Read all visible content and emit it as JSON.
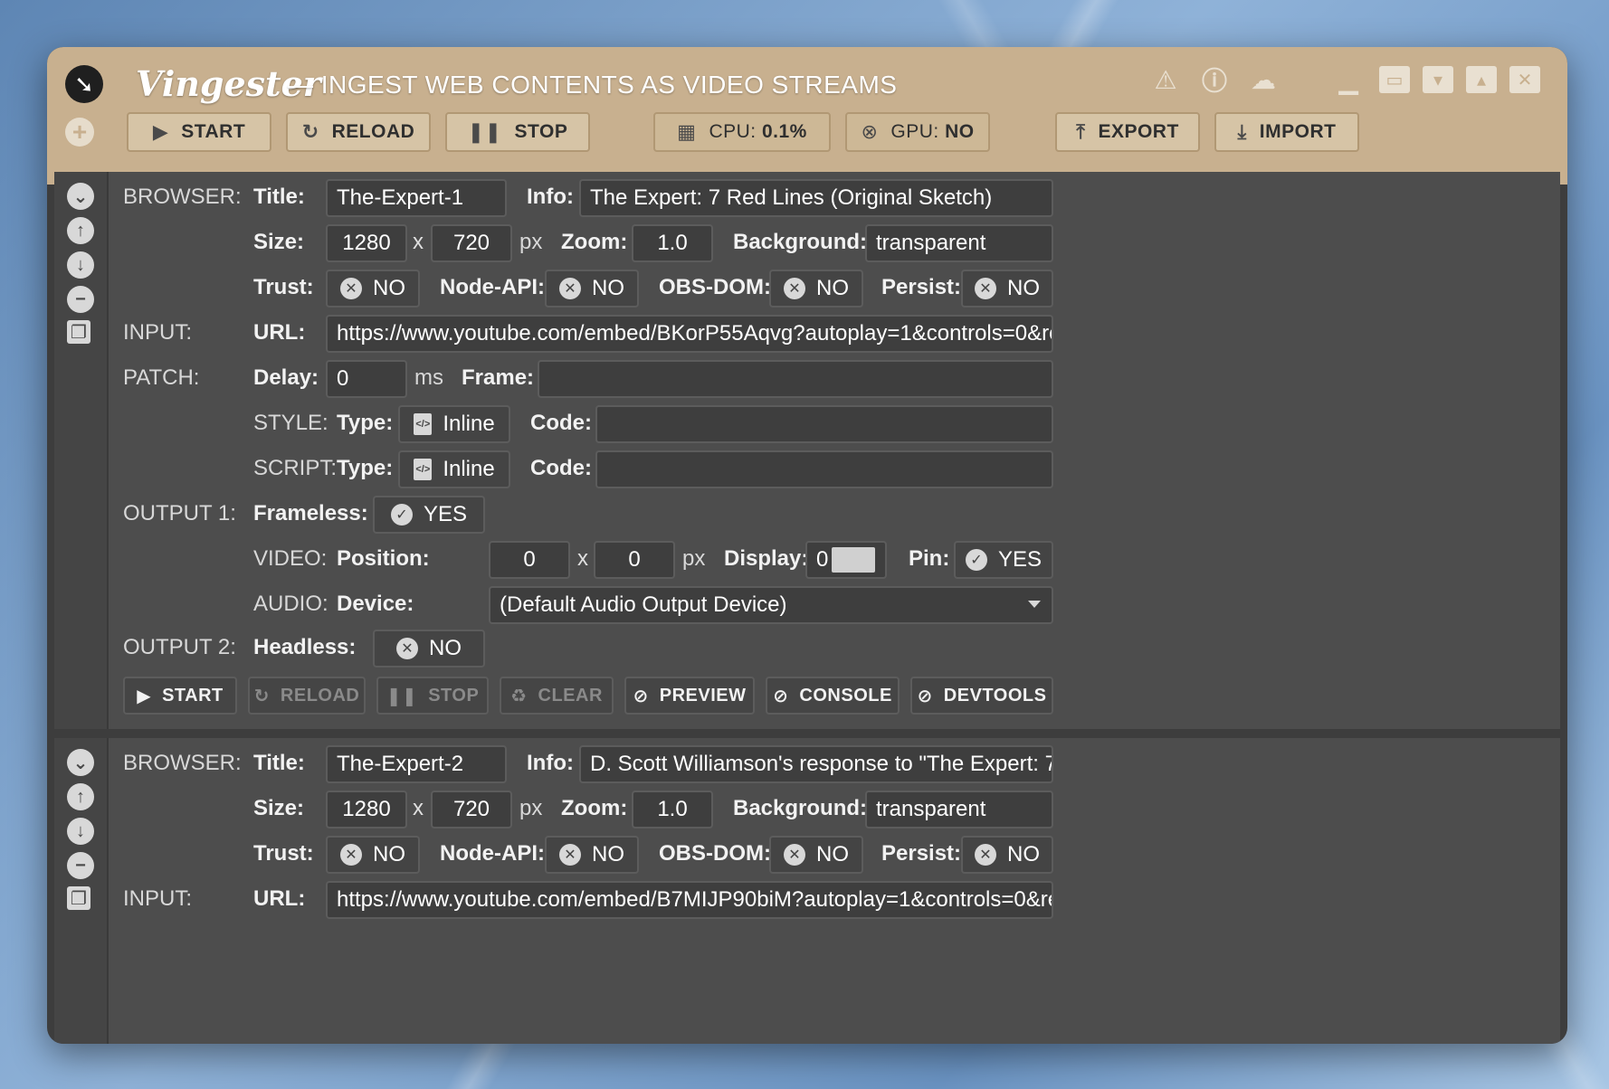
{
  "window": {
    "title": "Vingester",
    "subtitle": "— INGEST WEB CONTENTS AS VIDEO STREAMS"
  },
  "toolbar": {
    "start_label": "START",
    "reload_label": "RELOAD",
    "stop_label": "STOP",
    "cpu_label": "CPU:",
    "cpu_value": "0.1%",
    "gpu_label": "GPU:",
    "gpu_value": "NO",
    "export_label": "EXPORT",
    "import_label": "IMPORT"
  },
  "labels": {
    "browser": "BROWSER:",
    "title": "Title:",
    "info": "Info:",
    "size": "Size:",
    "x": "x",
    "px": "px",
    "zoom": "Zoom:",
    "background": "Background:",
    "trust": "Trust:",
    "node_api": "Node-API:",
    "obs_dom": "OBS-DOM:",
    "persist": "Persist:",
    "input": "INPUT:",
    "url": "URL:",
    "patch": "PATCH:",
    "delay": "Delay:",
    "ms": "ms",
    "frame": "Frame:",
    "style": "STYLE:",
    "script": "SCRIPT:",
    "type": "Type:",
    "code": "Code:",
    "output1": "OUTPUT 1:",
    "frameless": "Frameless:",
    "video": "VIDEO:",
    "position": "Position:",
    "display": "Display:",
    "pin": "Pin:",
    "audio": "AUDIO:",
    "device": "Device:",
    "output2": "OUTPUT 2:",
    "headless": "Headless:",
    "no": "NO",
    "yes": "YES",
    "inline": "Inline"
  },
  "browser1": {
    "title": "The-Expert-1",
    "info": "The Expert: 7 Red Lines (Original Sketch)",
    "width": "1280",
    "height": "720",
    "zoom": "1.0",
    "background": "transparent",
    "url": "https://www.youtube.com/embed/BKorP55Aqvg?autoplay=1&controls=0&re",
    "delay": "0",
    "frame": "",
    "style_code": "",
    "script_code": "",
    "pos_x": "0",
    "pos_y": "0",
    "display": "0",
    "audio_device": "(Default Audio Output Device)"
  },
  "browser2": {
    "title": "The-Expert-2",
    "info": "D. Scott Williamson's response to \"The Expert: 7",
    "width": "1280",
    "height": "720",
    "zoom": "1.0",
    "background": "transparent",
    "url": "https://www.youtube.com/embed/B7MIJP90biM?autoplay=1&controls=0&rel"
  },
  "actions": {
    "start": "START",
    "reload": "RELOAD",
    "stop": "STOP",
    "clear": "CLEAR",
    "preview": "PREVIEW",
    "console": "CONSOLE",
    "devtools": "DEVTOOLS"
  },
  "icons": [
    "app-logo-icon",
    "warning-icon",
    "info-icon",
    "cloud-download-icon",
    "minimize-icon",
    "maximize-icon",
    "collapse-icon",
    "expand-icon",
    "close-icon",
    "add-icon",
    "play-icon",
    "reload-icon",
    "pause-icon",
    "chip-icon",
    "x-circle-icon",
    "upload-icon",
    "download-icon",
    "chevron-down-circle-icon",
    "arrow-up-icon",
    "arrow-down-icon",
    "minus-icon",
    "copy-icon",
    "check-circle-icon",
    "code-file-icon",
    "recycle-icon",
    "eye-slash-icon"
  ]
}
